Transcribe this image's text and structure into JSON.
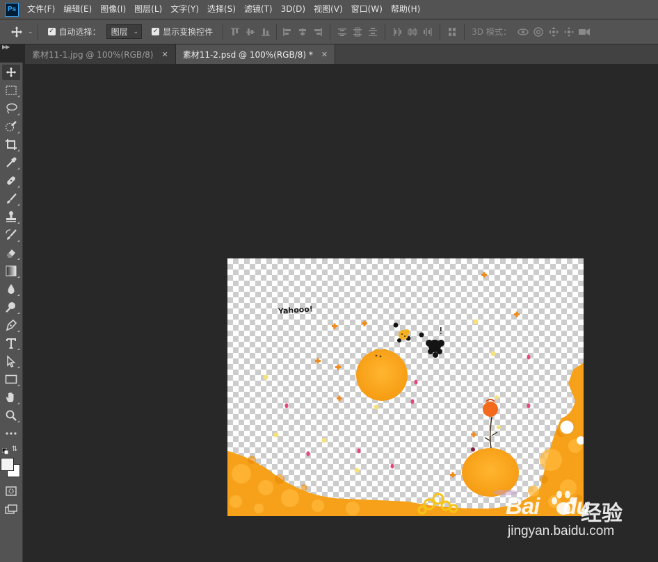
{
  "app": {
    "logo_text": "Ps"
  },
  "menu": [
    "文件(F)",
    "编辑(E)",
    "图像(I)",
    "图层(L)",
    "文字(Y)",
    "选择(S)",
    "滤镜(T)",
    "3D(D)",
    "视图(V)",
    "窗口(W)",
    "帮助(H)"
  ],
  "options": {
    "auto_select_label": "自动选择：",
    "auto_select_checked": true,
    "auto_select_target": "图层",
    "show_transform_label": "显示变换控件",
    "show_transform_checked": true,
    "mode_3d_label": "3D 模式："
  },
  "tabs": [
    {
      "title": "素材11-1.jpg @ 100%(RGB/8)",
      "active": false
    },
    {
      "title": "素材11-2.psd @ 100%(RGB/8) *",
      "active": true
    }
  ],
  "tools": [
    "move-icon",
    "marquee-icon",
    "lasso-icon",
    "quick-select-icon",
    "crop-icon",
    "eyedropper-icon",
    "healing-icon",
    "brush-icon",
    "stamp-icon",
    "history-brush-icon",
    "eraser-icon",
    "gradient-icon",
    "blur-icon",
    "dodge-icon",
    "pen-icon",
    "type-icon",
    "path-select-icon",
    "rectangle-icon",
    "hand-icon",
    "zoom-icon",
    "more-icon"
  ],
  "colors": {
    "foreground": "#f2f2f2",
    "background": "#ffffff",
    "accent": "#31a8ff",
    "orange": "#f7a21b"
  },
  "canvas": {
    "text": "Yahooo!"
  },
  "watermark": {
    "logo": "Bai",
    "logo_suffix": "du",
    "cn": "经验",
    "url": "jingyan.baidu.com"
  }
}
